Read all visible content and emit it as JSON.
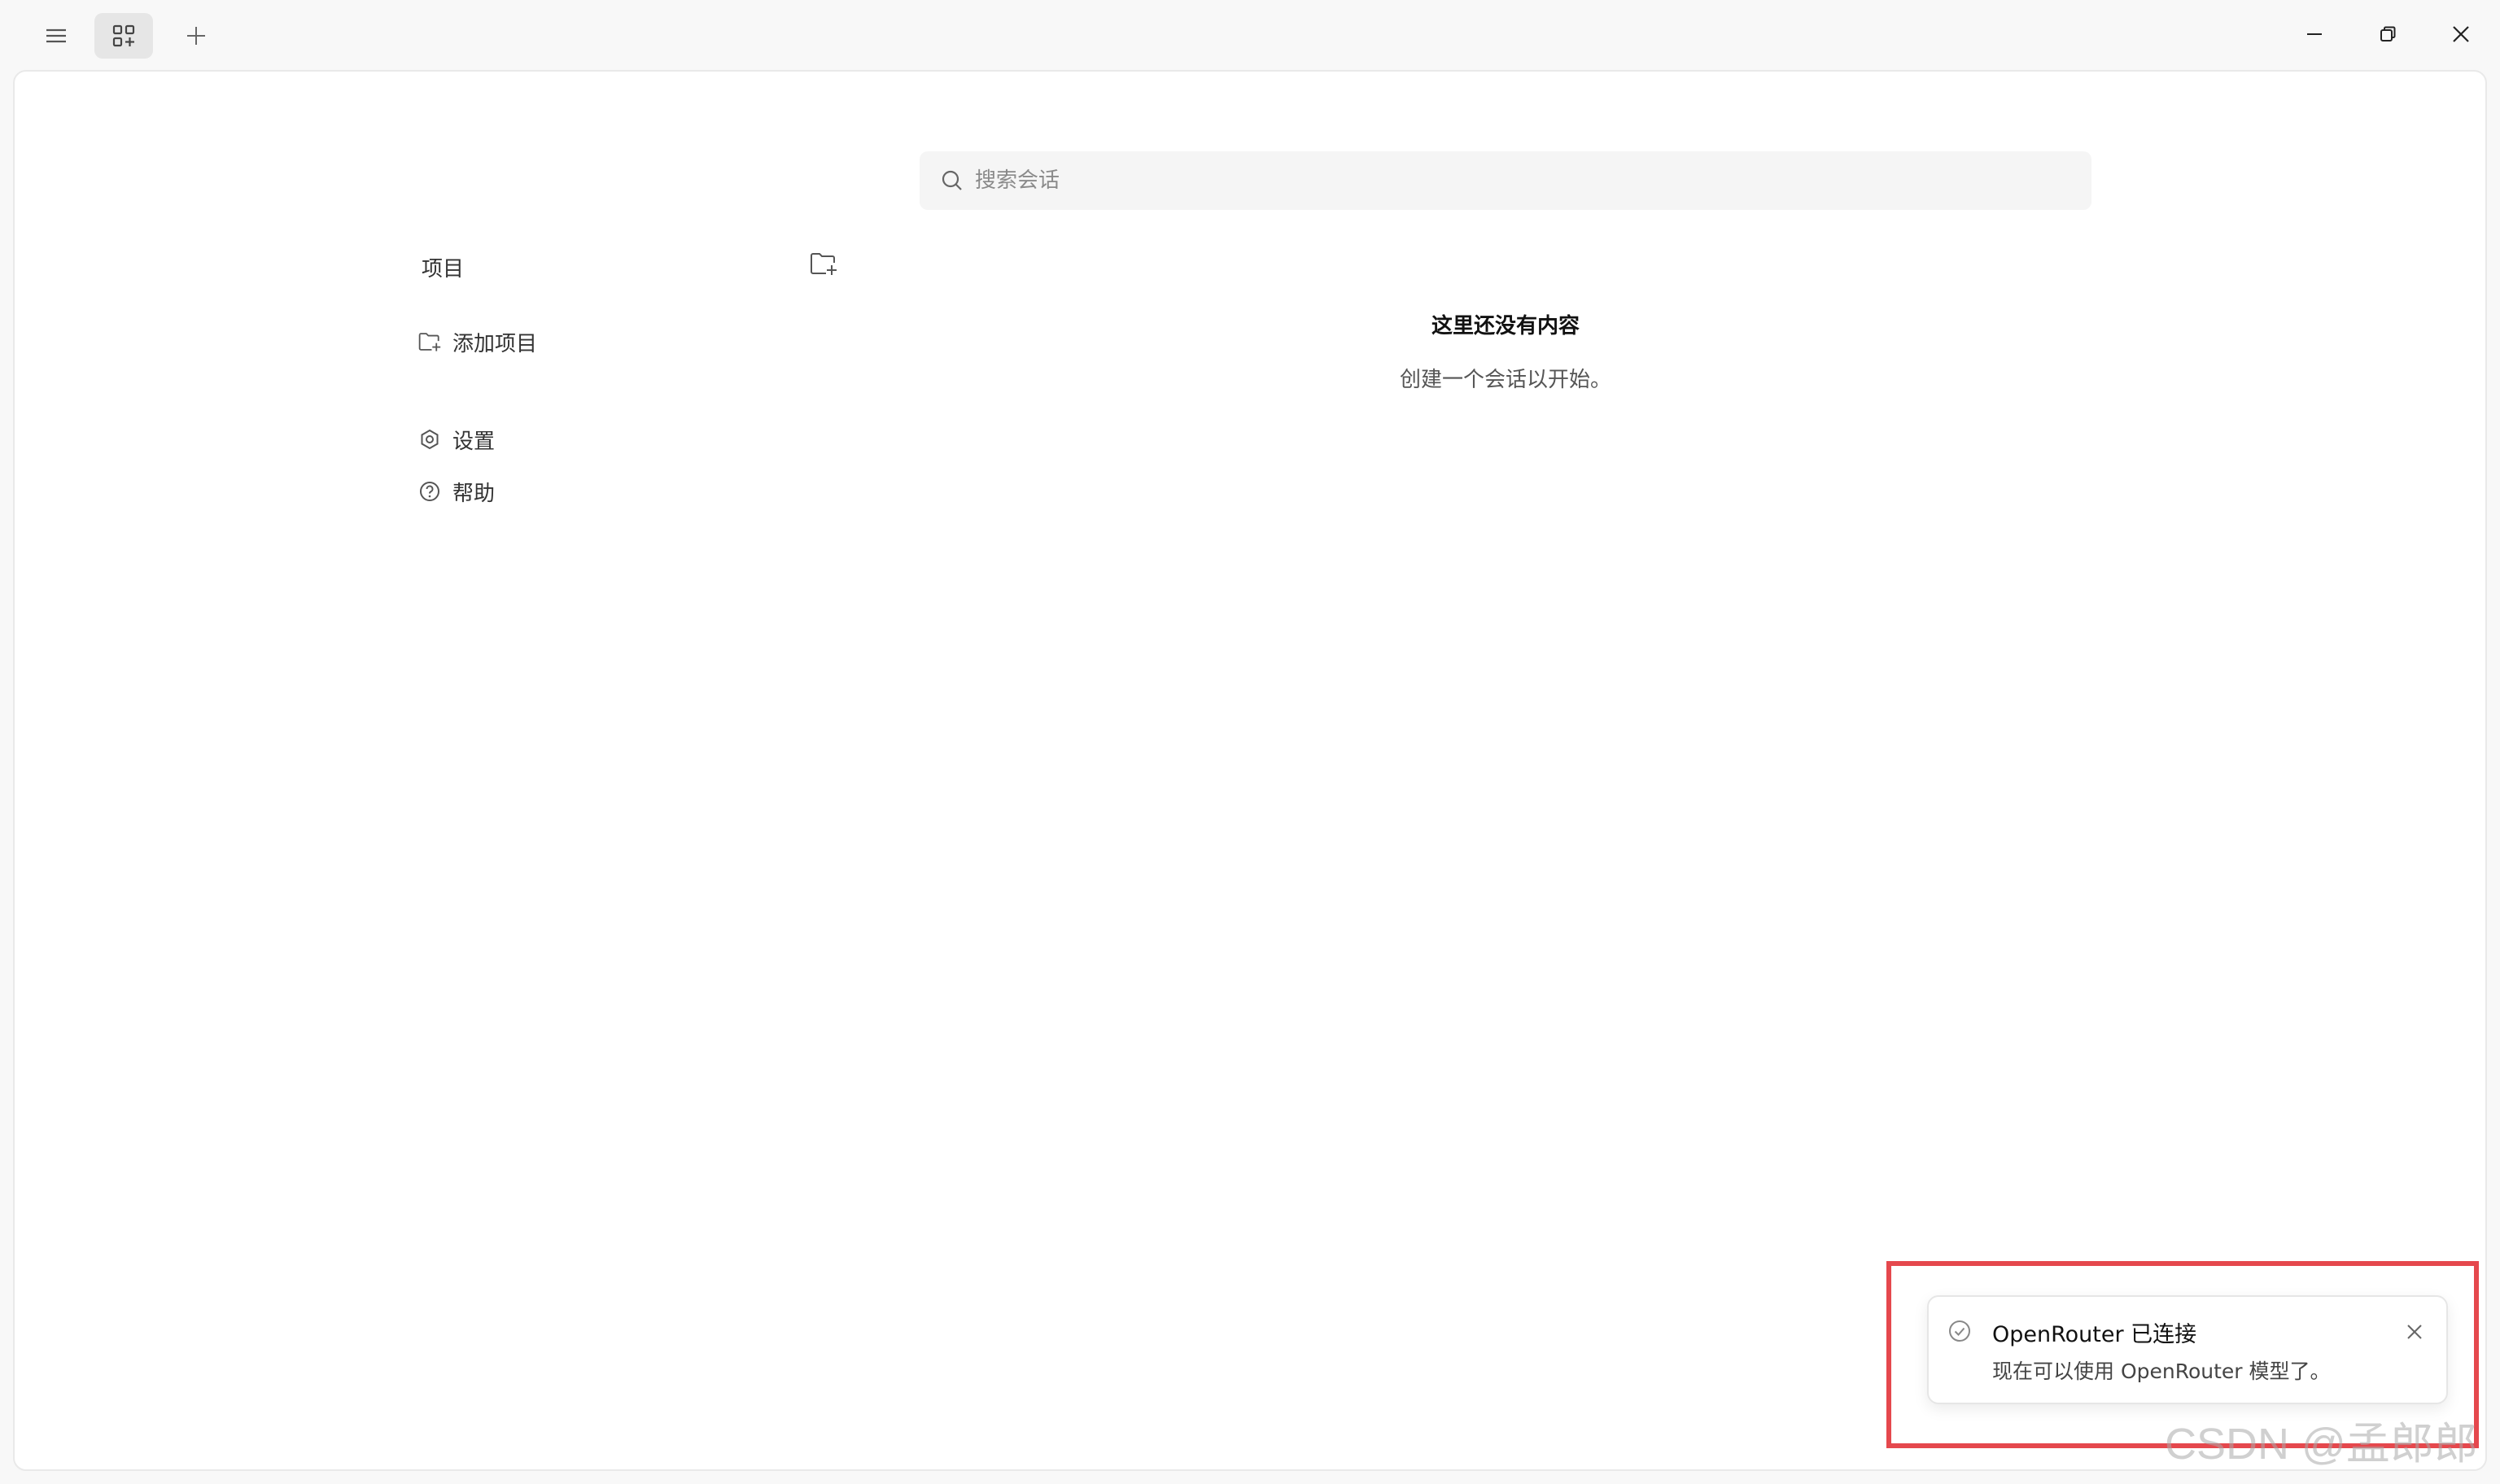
{
  "titlebar": {
    "menu_icon": "hamburger-menu-icon",
    "tabs_icon": "grid-plus-icon",
    "add_icon": "plus-icon",
    "minimize_icon": "minimize-icon",
    "restore_icon": "restore-icon",
    "close_icon": "close-icon"
  },
  "sidebar": {
    "projects_title": "项目",
    "new_folder_icon": "folder-plus-icon",
    "add_project": {
      "icon": "folder-plus-icon",
      "label": "添加项目"
    },
    "settings": {
      "icon": "gear-icon",
      "label": "设置"
    },
    "help": {
      "icon": "help-circle-icon",
      "label": "帮助"
    }
  },
  "search": {
    "icon": "search-icon",
    "placeholder": "搜索会话",
    "value": ""
  },
  "empty_state": {
    "title": "这里还没有内容",
    "subtitle": "创建一个会话以开始。"
  },
  "toast": {
    "icon": "check-circle-icon",
    "title": "OpenRouter 已连接",
    "body": "现在可以使用 OpenRouter 模型了。",
    "close_icon": "close-icon"
  },
  "colors": {
    "highlight_border": "#e5484d",
    "background": "#f8f8f8",
    "card": "#ffffff"
  },
  "watermark": "CSDN @孟郎郎"
}
